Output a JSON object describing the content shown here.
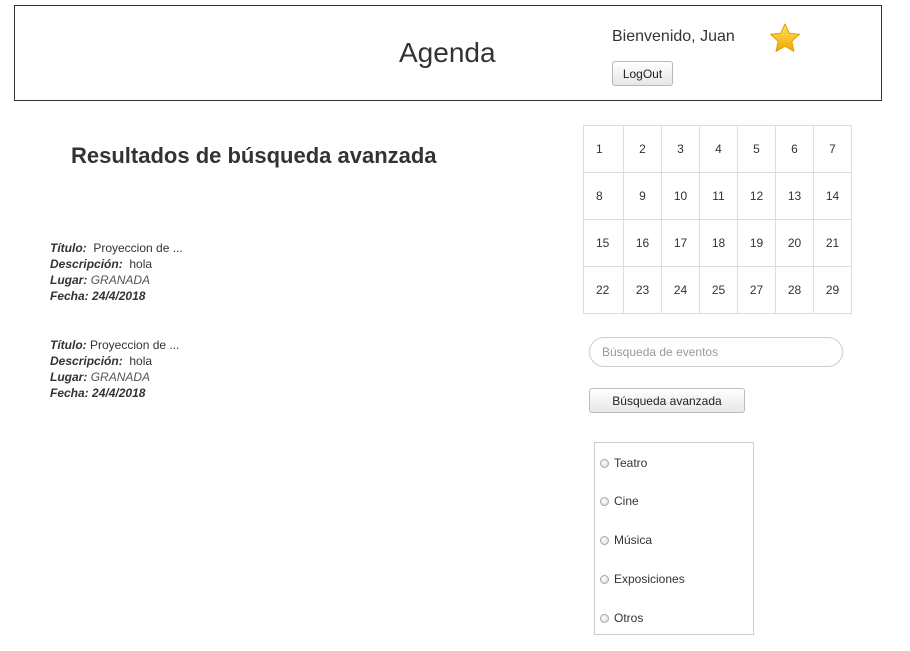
{
  "header": {
    "title": "Agenda",
    "welcome": "Bienvenido, Juan",
    "logout_label": "LogOut",
    "star_color": "#f5c518"
  },
  "results": {
    "heading": "Resultados de búsqueda avanzada",
    "labels": {
      "title": "Título:",
      "description": "Descripción:",
      "place": "Lugar:",
      "date": "Fecha:"
    },
    "events": [
      {
        "title": "Proyeccion de ...",
        "description": "hola",
        "place": "GRANADA",
        "date": "24/4/2018"
      },
      {
        "title": "Proyeccion de ...",
        "description": "hola",
        "place": "GRANADA",
        "date": "24/4/2018"
      }
    ]
  },
  "calendar": {
    "weeks": [
      [
        "1",
        "2",
        "3",
        "4",
        "5",
        "6",
        "7"
      ],
      [
        "8",
        "9",
        "10",
        "11",
        "12",
        "13",
        "14"
      ],
      [
        "15",
        "16",
        "17",
        "18",
        "19",
        "20",
        "21"
      ],
      [
        "22",
        "23",
        "24",
        "25",
        "27",
        "28",
        "29"
      ]
    ]
  },
  "search": {
    "placeholder": "Búsqueda de eventos",
    "advanced_label": "Búsqueda avanzada"
  },
  "categories": [
    {
      "label": "Teatro"
    },
    {
      "label": "Cine"
    },
    {
      "label": "Música"
    },
    {
      "label": "Exposiciones"
    },
    {
      "label": "Otros"
    }
  ]
}
